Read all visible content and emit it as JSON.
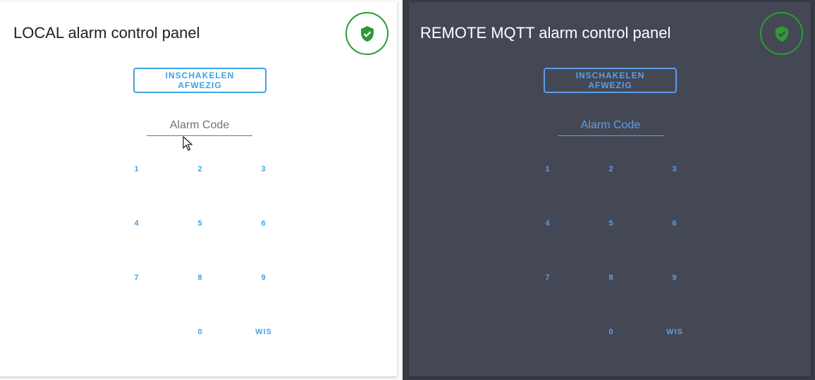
{
  "local_panel": {
    "title": "LOCAL alarm control panel",
    "state_icon": "shield-check-icon",
    "arm_button_label": "INSCHAKELEN AFWEZIG",
    "code_placeholder": "Alarm Code",
    "keys": [
      "1",
      "2",
      "3",
      "4",
      "5",
      "6",
      "7",
      "8",
      "9",
      "0",
      "WIS"
    ]
  },
  "remote_panel": {
    "title": "REMOTE MQTT alarm control panel",
    "state_icon": "shield-check-icon",
    "arm_button_label": "INSCHAKELEN AFWEZIG",
    "code_placeholder": "Alarm Code",
    "keys": [
      "1",
      "2",
      "3",
      "4",
      "5",
      "6",
      "7",
      "8",
      "9",
      "0",
      "WIS"
    ]
  },
  "colors": {
    "state_armed": "#2e9a36",
    "accent_light": "#3fa4e0",
    "accent_dark": "#5c9ee8",
    "dark_card": "#444854"
  }
}
